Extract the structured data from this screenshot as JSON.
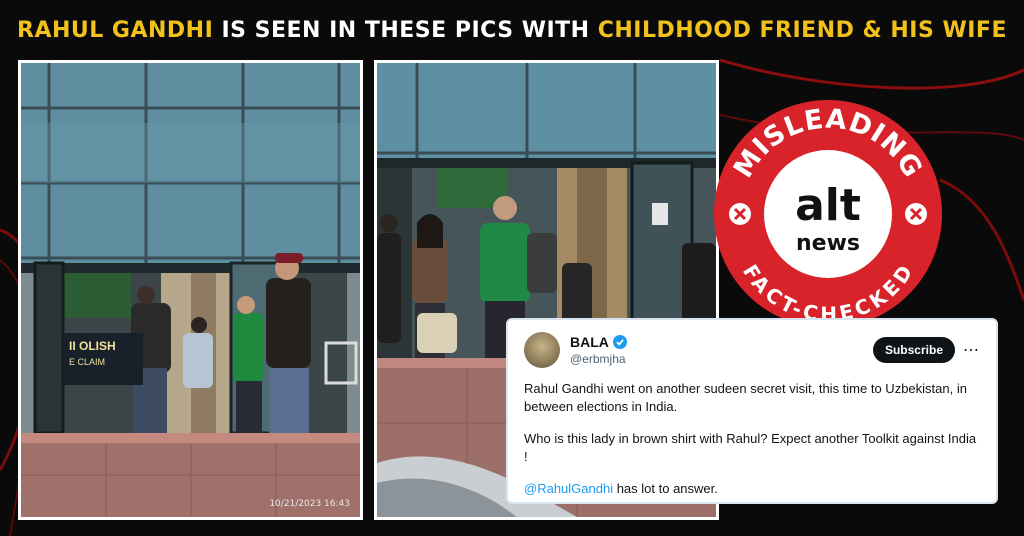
{
  "headline": {
    "part1": "RAHUL GANDHI",
    "part2": " IS SEEN IN THESE PICS WITH ",
    "part3": "CHILDHOOD FRIEND & HIS WIFE",
    "highlight_color": "#f2c21b"
  },
  "photos": {
    "left": {
      "timestamp": "10/21/2023  16:43",
      "sign_line1": "II OLISH",
      "sign_line2": "E CLAIM"
    },
    "right": {}
  },
  "stamp": {
    "top_text": "MISLEADING",
    "logo_line1": "alt",
    "logo_line2": "news",
    "bottom_text": "FACT-CHECKED",
    "color": "#d8232a"
  },
  "tweet": {
    "name": "BALA",
    "handle": "@erbmjha",
    "subscribe_label": "Subscribe",
    "more_icon": "more-options-icon",
    "para1": "Rahul Gandhi went on another sudeen secret visit, this time to Uzbekistan, in between elections in India.",
    "para2": "Who is this lady in brown shirt with Rahul? Expect another Toolkit against India !",
    "mention": "@RahulGandhi",
    "para3_rest": " has lot to answer."
  }
}
